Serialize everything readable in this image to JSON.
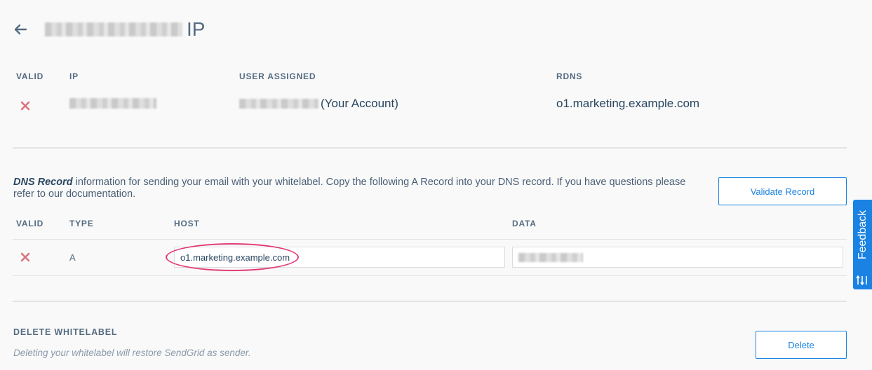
{
  "header": {
    "title_suffix": "IP"
  },
  "ip_table": {
    "columns": [
      "VALID",
      "IP",
      "USER ASSIGNED",
      "RDNS"
    ],
    "row": {
      "user_assigned_suffix": "(Your Account)",
      "rdns": "o1.marketing.example.com"
    }
  },
  "dns": {
    "desc_bold": "DNS Record",
    "desc_rest": " information for sending your email with your whitelabel. Copy the following A Record into your DNS record. If you have questions please refer to our documentation.",
    "validate_label": "Validate Record",
    "columns": [
      "VALID",
      "TYPE",
      "HOST",
      "DATA"
    ],
    "row": {
      "type": "A",
      "host": "o1.marketing.example.com"
    }
  },
  "delete_section": {
    "title": "DELETE WHITELABEL",
    "note": "Deleting your whitelabel will restore SendGrid as sender.",
    "button_label": "Delete"
  },
  "feedback": {
    "label": "Feedback"
  },
  "colors": {
    "accent": "#1a82e2",
    "invalid": "#d9737d",
    "highlight": "#e23b78"
  }
}
